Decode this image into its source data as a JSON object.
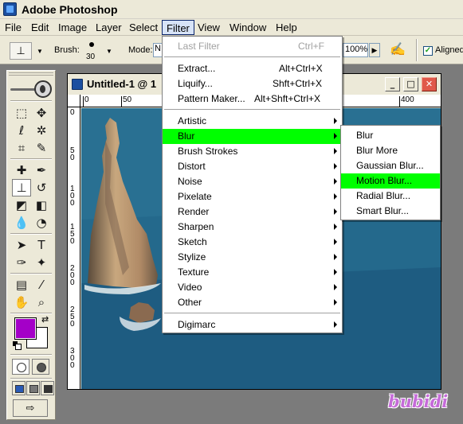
{
  "app": {
    "title": "Adobe Photoshop"
  },
  "menubar": [
    "File",
    "Edit",
    "Image",
    "Layer",
    "Select",
    "Filter",
    "View",
    "Window",
    "Help"
  ],
  "options_bar": {
    "brush_label": "Brush:",
    "brush_size": "30",
    "mode_label": "Mode:",
    "mode_value": "N",
    "flow_value": "100%",
    "aligned_label": "Aligned",
    "aligned_checked": true
  },
  "toolbox": {
    "foreground_color": "#a400c8",
    "background_color": "#ffffff"
  },
  "document": {
    "title": "Untitled-1 @ 1",
    "h_ruler": [
      "0",
      "50",
      "400"
    ],
    "v_ruler": [
      "0",
      "5\n0",
      "1\n0\n0",
      "1\n5\n0",
      "2\n0\n0",
      "2\n5\n0",
      "3\n0\n0"
    ]
  },
  "filter_menu": [
    {
      "label": "Last Filter",
      "shortcut": "Ctrl+F",
      "disabled": true
    },
    {
      "separator": true
    },
    {
      "label": "Extract...",
      "shortcut": "Alt+Ctrl+X"
    },
    {
      "label": "Liquify...",
      "shortcut": "Shft+Ctrl+X"
    },
    {
      "label": "Pattern Maker...",
      "shortcut": "Alt+Shft+Ctrl+X"
    },
    {
      "separator": true
    },
    {
      "label": "Artistic",
      "submenu": true
    },
    {
      "label": "Blur",
      "submenu": true,
      "highlighted": true
    },
    {
      "label": "Brush Strokes",
      "submenu": true
    },
    {
      "label": "Distort",
      "submenu": true
    },
    {
      "label": "Noise",
      "submenu": true
    },
    {
      "label": "Pixelate",
      "submenu": true
    },
    {
      "label": "Render",
      "submenu": true
    },
    {
      "label": "Sharpen",
      "submenu": true
    },
    {
      "label": "Sketch",
      "submenu": true
    },
    {
      "label": "Stylize",
      "submenu": true
    },
    {
      "label": "Texture",
      "submenu": true
    },
    {
      "label": "Video",
      "submenu": true
    },
    {
      "label": "Other",
      "submenu": true
    },
    {
      "separator": true
    },
    {
      "label": "Digimarc",
      "submenu": true
    }
  ],
  "blur_submenu": [
    {
      "label": "Blur"
    },
    {
      "label": "Blur More"
    },
    {
      "label": "Gaussian Blur..."
    },
    {
      "label": "Motion Blur...",
      "highlighted": true
    },
    {
      "label": "Radial Blur..."
    },
    {
      "label": "Smart Blur..."
    }
  ],
  "watermark": "bubidi",
  "colors": {
    "highlight": "#00ff00",
    "menu_active_border": "#0a246a"
  }
}
